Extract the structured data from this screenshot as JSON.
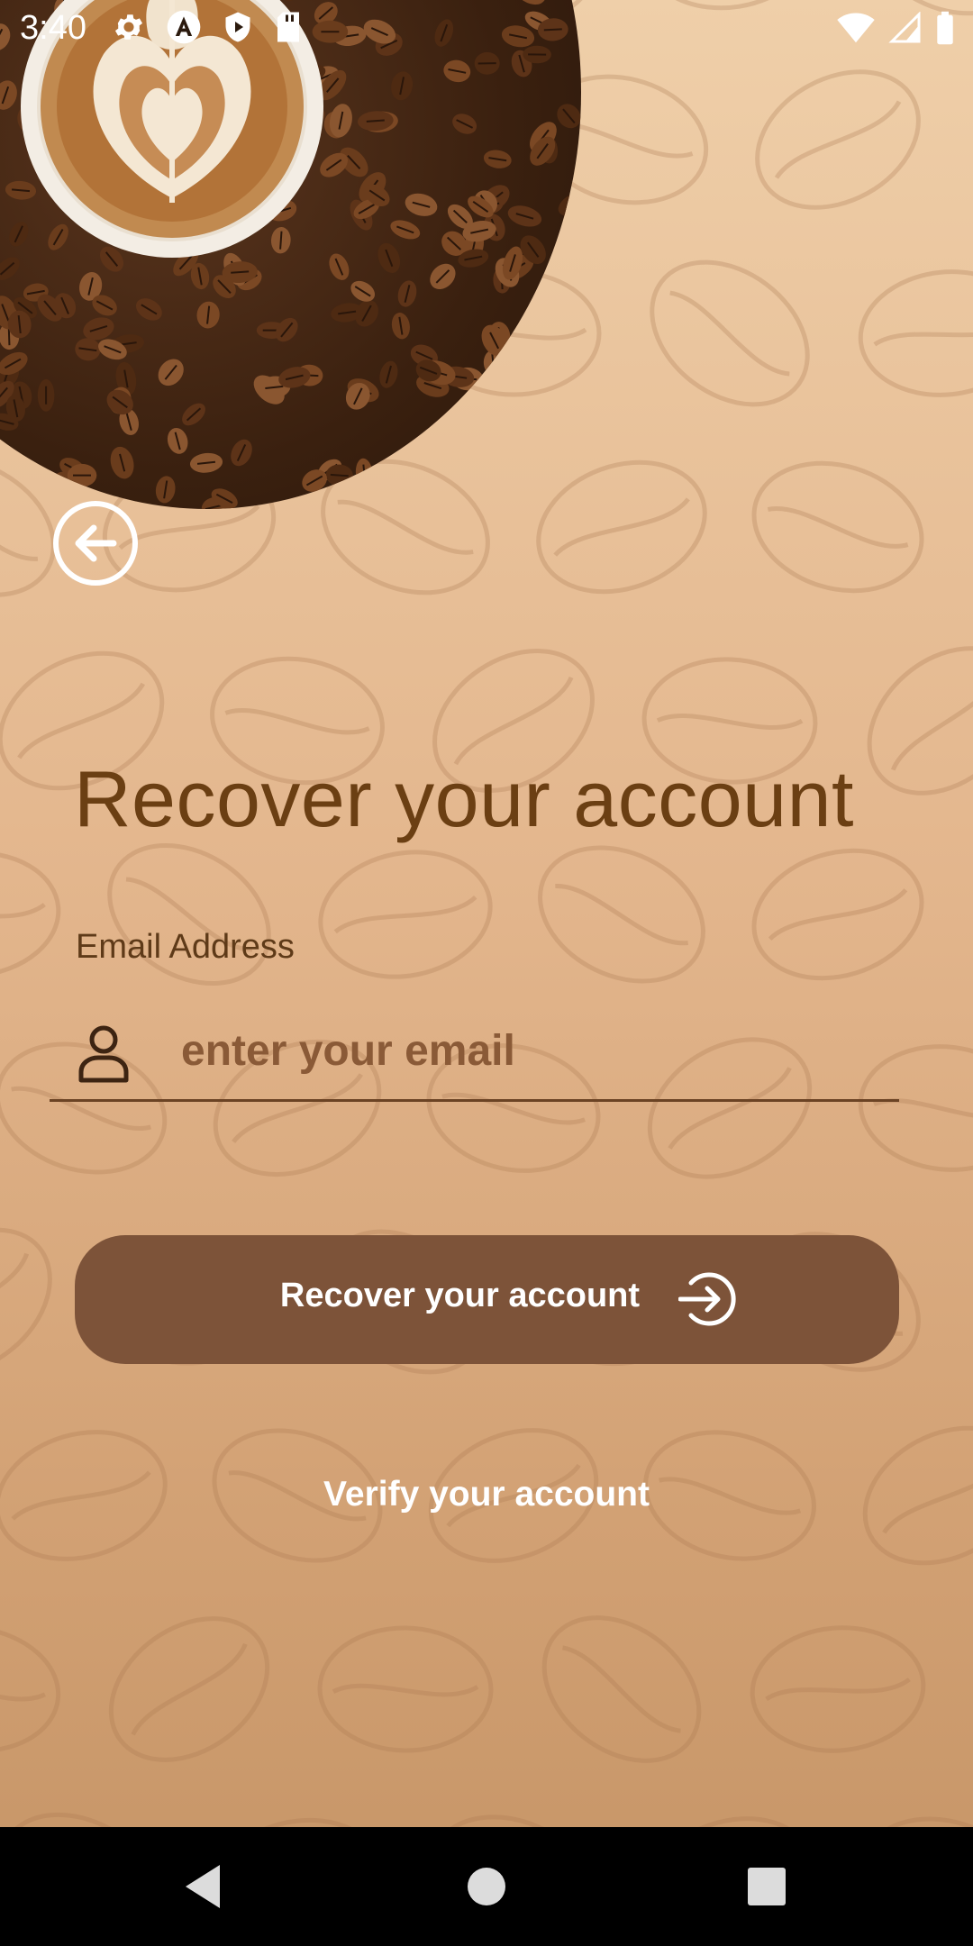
{
  "status_bar": {
    "time": "3:40",
    "left_icons": [
      "settings-icon",
      "autofill-a-icon",
      "play-protect-icon",
      "sd-card-icon"
    ],
    "right_icons": [
      "wifi-icon",
      "cell-signal-icon",
      "battery-icon"
    ]
  },
  "hero": {
    "image": "coffee-latte-art-on-beans"
  },
  "back": {
    "icon": "back-arrow-circle-icon"
  },
  "page": {
    "title": "Recover your account"
  },
  "form": {
    "email_label": "Email Address",
    "email_placeholder": "enter your email",
    "email_value": "",
    "email_icon": "user-icon"
  },
  "actions": {
    "recover_label": "Recover your account",
    "recover_icon": "login-arrow-icon",
    "verify_label": "Verify your account"
  },
  "nav_bar": {
    "buttons": [
      "back-triangle-icon",
      "home-circle-icon",
      "recents-square-icon"
    ]
  },
  "colors": {
    "title": "#6b3f13",
    "button": "#7d5339",
    "background_top": "#efcfa9",
    "background_bottom": "#c59466"
  }
}
